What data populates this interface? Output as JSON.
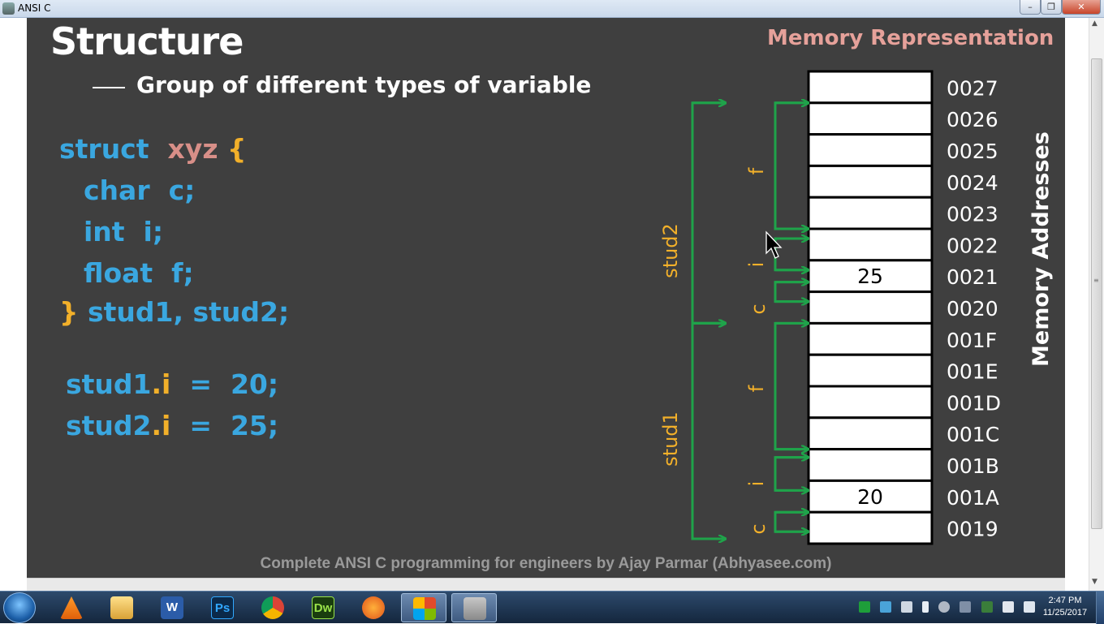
{
  "window": {
    "title": "ANSI C"
  },
  "slide": {
    "title": "Structure",
    "subtitle": "Group of different types of variable",
    "memory_heading": "Memory Representation",
    "code": {
      "l1_kw": "struct",
      "l1_name": "xyz",
      "l1_brace": "{",
      "l2": "char  c;",
      "l3": "int  i;",
      "l4": "float  f;",
      "l5_brace": "}",
      "l5_rest": "stud1, stud2;",
      "a1_var": "stud1",
      "a1_dot": ".",
      "a1_member": "i",
      "a1_rest": "  =  20;",
      "a2_var": "stud2",
      "a2_dot": ".",
      "a2_member": "i",
      "a2_rest": "  =  25;"
    },
    "memory": {
      "addresses": [
        "0027",
        "0026",
        "0025",
        "0024",
        "0023",
        "0022",
        "0021",
        "0020",
        "001F",
        "001E",
        "001D",
        "001C",
        "001B",
        "001A",
        "0019"
      ],
      "values": [
        "",
        "",
        "",
        "",
        "",
        "",
        "25",
        "",
        "",
        "",
        "",
        "",
        "",
        "20",
        ""
      ],
      "axis_label": "Memory Addresses",
      "labels": {
        "stud2": "stud2",
        "stud1": "stud1",
        "f2": "f",
        "i2": "i",
        "c2": "c",
        "f1": "f",
        "i1": "i",
        "c1": "c"
      }
    },
    "footer": "Complete ANSI C programming for engineers by Ajay Parmar (Abhyasee.com)"
  },
  "taskbar": {
    "clock_time": "2:47 PM",
    "clock_date": "11/25/2017",
    "apps": [
      {
        "name": "vlc-icon",
        "label": ""
      },
      {
        "name": "file-explorer-icon",
        "label": ""
      },
      {
        "name": "word-icon",
        "label": "W"
      },
      {
        "name": "photoshop-icon",
        "label": "Ps"
      },
      {
        "name": "chrome-icon",
        "label": ""
      },
      {
        "name": "dreamweaver-icon",
        "label": "Dw"
      },
      {
        "name": "firefox-icon",
        "label": ""
      },
      {
        "name": "office-icon",
        "label": ""
      },
      {
        "name": "media-player-icon",
        "label": ""
      }
    ]
  },
  "colors": {
    "slide_bg": "#3f3f3f",
    "arrow_green": "#1fa34a",
    "accent_yellow": "#f2b02a",
    "code_blue": "#3aa7e0",
    "heading_pink": "#e6a19a"
  }
}
